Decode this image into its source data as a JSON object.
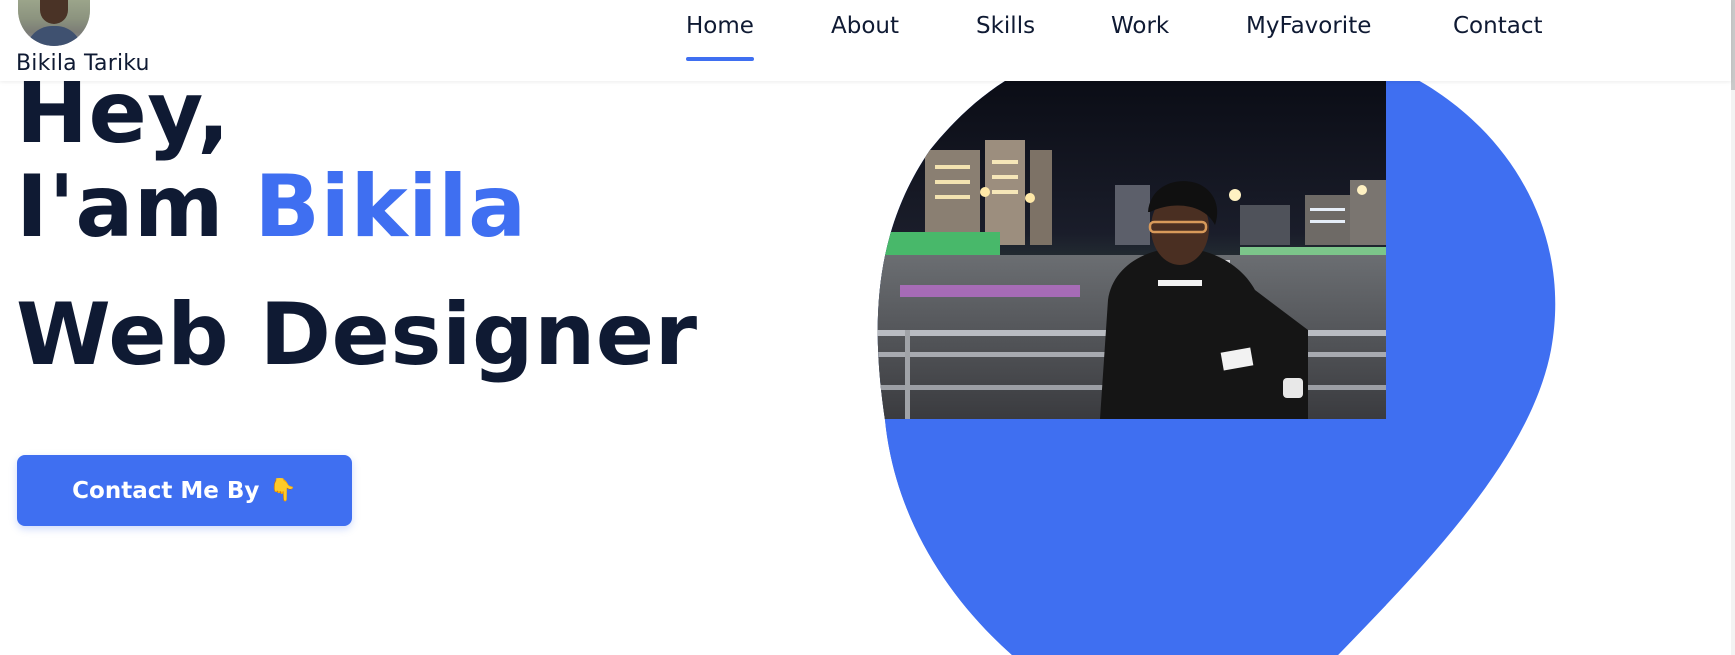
{
  "header": {
    "brand_name": "Bikila Tariku",
    "nav": [
      {
        "label": "Home",
        "active": true
      },
      {
        "label": "About",
        "active": false
      },
      {
        "label": "Skills",
        "active": false
      },
      {
        "label": "Work",
        "active": false
      },
      {
        "label": "MyFavorite",
        "active": false
      },
      {
        "label": "Contact",
        "active": false
      }
    ]
  },
  "hero": {
    "greeting": "Hey,",
    "intro_prefix": "I'am ",
    "intro_name": "Bikila",
    "role": "Web Designer",
    "cta_label": "Contact Me By",
    "cta_icon": "pointing-down-hand-icon",
    "cta_emoji": "👇"
  },
  "colors": {
    "accent": "#3f6ff1",
    "text_dark": "#0f1a33",
    "background": "#ffffff"
  }
}
